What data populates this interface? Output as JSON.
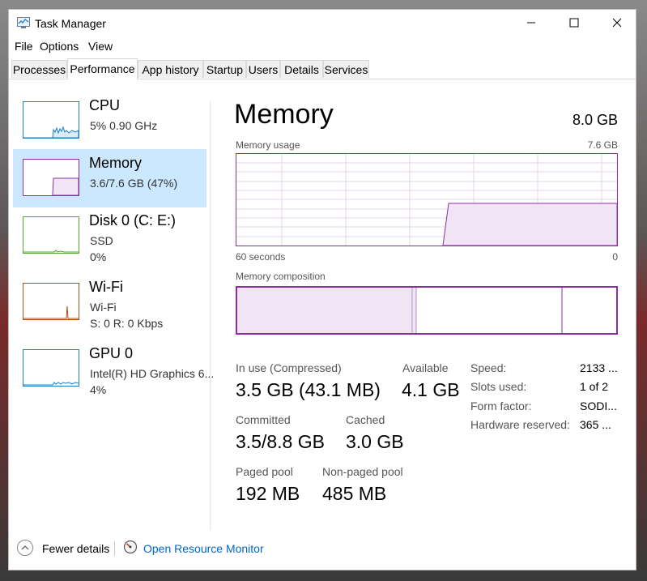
{
  "window": {
    "title": "Task Manager",
    "controls": {
      "minimize": "–",
      "maximize": "☐",
      "close": "✕"
    }
  },
  "menu": [
    "File",
    "Options",
    "View"
  ],
  "tabs": [
    "Processes",
    "Performance",
    "App history",
    "Startup",
    "Users",
    "Details",
    "Services"
  ],
  "active_tab": "Performance",
  "sidebar": [
    {
      "name": "CPU",
      "line1": "5%  0.90 GHz",
      "line2": "",
      "color": "#1b7fc4"
    },
    {
      "name": "Memory",
      "line1": "3.6/7.6 GB (47%)",
      "line2": "",
      "color": "#8b2ea3"
    },
    {
      "name": "Disk 0 (C: E:)",
      "line1": "SSD",
      "line2": "0%",
      "color": "#4ca82c"
    },
    {
      "name": "Wi-Fi",
      "line1": "Wi-Fi",
      "line2": "S: 0  R: 0 Kbps",
      "color": "#a7501a"
    },
    {
      "name": "GPU 0",
      "line1": "Intel(R) HD Graphics 6...",
      "line2": "4%",
      "color": "#1b7fc4"
    }
  ],
  "main": {
    "title": "Memory",
    "total": "8.0 GB",
    "usage_label": "Memory usage",
    "usage_max": "7.6 GB",
    "time_left": "60 seconds",
    "time_right": "0",
    "composition_label": "Memory composition",
    "stats": {
      "in_use_label": "In use (Compressed)",
      "in_use_value": "3.5 GB (43.1 MB)",
      "available_label": "Available",
      "available_value": "4.1 GB",
      "committed_label": "Committed",
      "committed_value": "3.5/8.8 GB",
      "cached_label": "Cached",
      "cached_value": "3.0 GB",
      "paged_label": "Paged pool",
      "paged_value": "192 MB",
      "nonpaged_label": "Non-paged pool",
      "nonpaged_value": "485 MB"
    },
    "details": [
      {
        "label": "Speed:",
        "value": "2133 ..."
      },
      {
        "label": "Slots used:",
        "value": "1 of 2"
      },
      {
        "label": "Form factor:",
        "value": "SODI..."
      },
      {
        "label": "Hardware reserved:",
        "value": "365 ..."
      }
    ]
  },
  "footer": {
    "fewer_details": "Fewer details",
    "open_resource_monitor": "Open Resource Monitor"
  },
  "colors": {
    "accent_memory": "#8b2ea3",
    "selected_bg": "#cce8ff",
    "link": "#0066cc"
  }
}
